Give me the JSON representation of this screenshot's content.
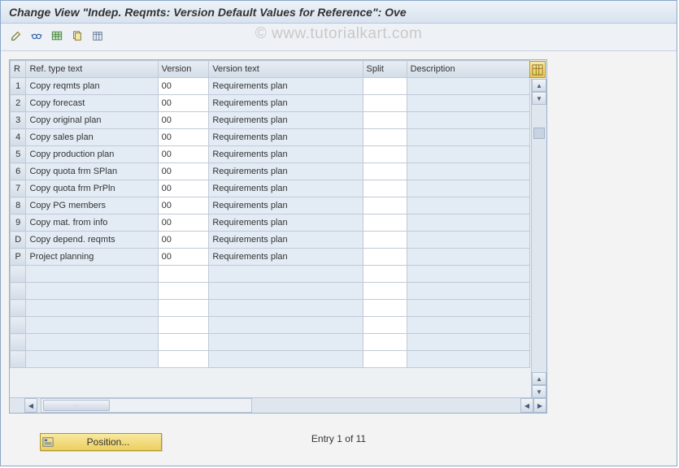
{
  "window": {
    "title": "Change View \"Indep. Reqmts: Version Default Values for Reference\": Ove"
  },
  "watermark": "©  www.tutorialkart.com",
  "toolbar": {
    "items": [
      {
        "name": "edit-entry-icon",
        "glyph": "pencil"
      },
      {
        "name": "glasses-icon",
        "glyph": "glasses"
      },
      {
        "name": "new-entries-icon",
        "glyph": "table"
      },
      {
        "name": "copy-as-icon",
        "glyph": "copy"
      },
      {
        "name": "delete-icon",
        "glyph": "delete"
      }
    ]
  },
  "grid": {
    "columns": {
      "row": "R",
      "ref": "Ref. type text",
      "ver": "Version",
      "vtx": "Version text",
      "spl": "Split",
      "dsc": "Description"
    },
    "rows": [
      {
        "r": "1",
        "ref": "Copy reqmts plan",
        "ver": "00",
        "vtx": "Requirements plan",
        "spl": "",
        "dsc": ""
      },
      {
        "r": "2",
        "ref": "Copy forecast",
        "ver": "00",
        "vtx": "Requirements plan",
        "spl": "",
        "dsc": ""
      },
      {
        "r": "3",
        "ref": "Copy original plan",
        "ver": "00",
        "vtx": "Requirements plan",
        "spl": "",
        "dsc": ""
      },
      {
        "r": "4",
        "ref": "Copy sales plan",
        "ver": "00",
        "vtx": "Requirements plan",
        "spl": "",
        "dsc": ""
      },
      {
        "r": "5",
        "ref": "Copy production plan",
        "ver": "00",
        "vtx": "Requirements plan",
        "spl": "",
        "dsc": ""
      },
      {
        "r": "6",
        "ref": "Copy quota frm SPlan",
        "ver": "00",
        "vtx": "Requirements plan",
        "spl": "",
        "dsc": ""
      },
      {
        "r": "7",
        "ref": "Copy quota frm PrPln",
        "ver": "00",
        "vtx": "Requirements plan",
        "spl": "",
        "dsc": ""
      },
      {
        "r": "8",
        "ref": "Copy PG members",
        "ver": "00",
        "vtx": "Requirements plan",
        "spl": "",
        "dsc": ""
      },
      {
        "r": "9",
        "ref": "Copy mat. from info",
        "ver": "00",
        "vtx": "Requirements plan",
        "spl": "",
        "dsc": ""
      },
      {
        "r": "D",
        "ref": "Copy depend. reqmts",
        "ver": "00",
        "vtx": "Requirements plan",
        "spl": "",
        "dsc": ""
      },
      {
        "r": "P",
        "ref": "Project planning",
        "ver": "00",
        "vtx": "Requirements plan",
        "spl": "",
        "dsc": ""
      }
    ],
    "empty_rows": 6
  },
  "status": {
    "entry_text": "Entry 1 of 11"
  },
  "buttons": {
    "position_label": "Position..."
  },
  "icons": {
    "config_corner": "table-config-icon"
  }
}
